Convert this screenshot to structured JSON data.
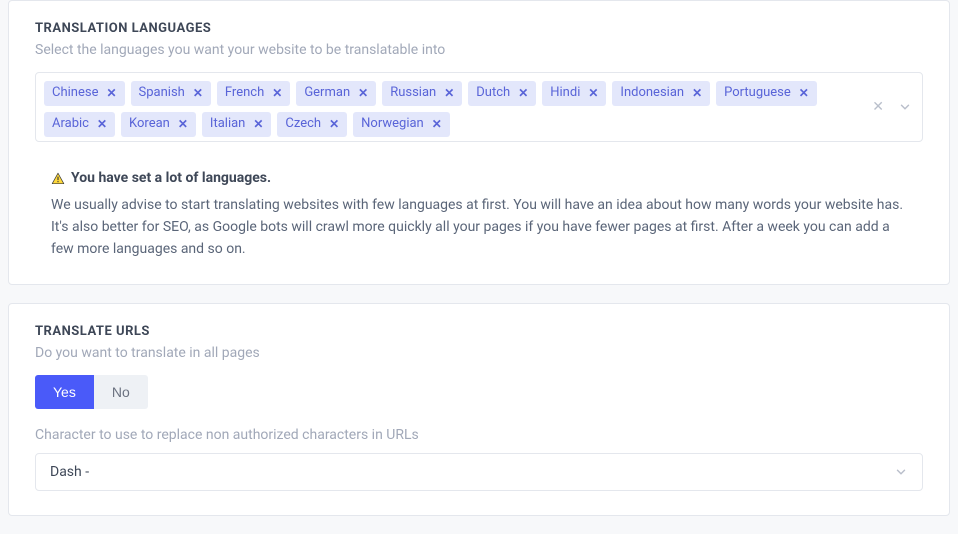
{
  "translation_languages": {
    "title": "TRANSLATION LANGUAGES",
    "subtitle": "Select the languages you want your website to be translatable into",
    "chips": [
      "Chinese",
      "Spanish",
      "French",
      "German",
      "Russian",
      "Dutch",
      "Hindi",
      "Indonesian",
      "Portuguese",
      "Arabic",
      "Korean",
      "Italian",
      "Czech",
      "Norwegian"
    ],
    "warning_title": "You have set a lot of languages.",
    "warning_body": "We usually advise to start translating websites with few languages at first. You will have an idea about how many words your website has. It's also better for SEO, as Google bots will crawl more quickly all your pages if you have fewer pages at first. After a week you can add a few more languages and so on."
  },
  "translate_urls": {
    "title": "TRANSLATE URLS",
    "subtitle": "Do you want to translate in all pages",
    "yes_label": "Yes",
    "no_label": "No",
    "char_label": "Character to use to replace non authorized characters in URLs",
    "selected": "Dash -"
  }
}
